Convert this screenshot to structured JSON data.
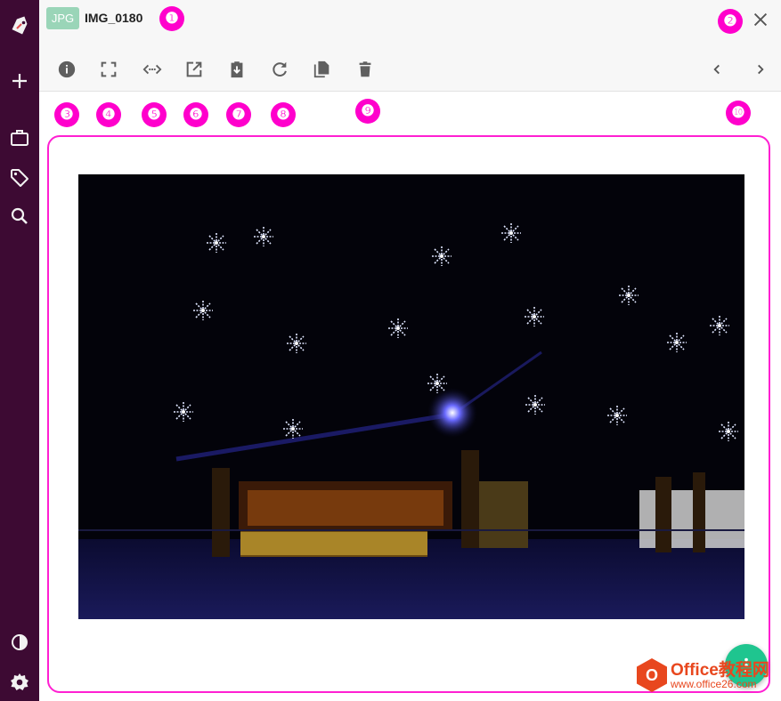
{
  "header": {
    "type_badge": "JPG",
    "filename": "IMG_0180"
  },
  "sidebar": {
    "items": [
      {
        "icon": "logo-tag-icon"
      },
      {
        "icon": "add-icon"
      },
      {
        "icon": "briefcase-icon"
      },
      {
        "icon": "tag-icon"
      },
      {
        "icon": "search-icon"
      },
      {
        "icon": "contrast-icon"
      },
      {
        "icon": "settings-icon"
      }
    ]
  },
  "toolbar": {
    "left": [
      "info-icon",
      "fullscreen-icon",
      "embed-code-icon",
      "open-external-icon",
      "download-icon",
      "rotate-icon",
      "copy-icon",
      "delete-icon"
    ],
    "right": [
      "previous-icon",
      "next-icon"
    ]
  },
  "callouts": [
    "❶",
    "❷",
    "❸",
    "❹",
    "❺",
    "❻",
    "❼",
    "❽",
    "❾",
    "❿"
  ],
  "watermark": {
    "name": "Office教程网",
    "url": "www.office26.com"
  },
  "colors": {
    "sidebar_bg": "#3d0a33",
    "callout": "#ff00cc",
    "badge": "#9ad5b8",
    "fab": "#1fc58f"
  }
}
